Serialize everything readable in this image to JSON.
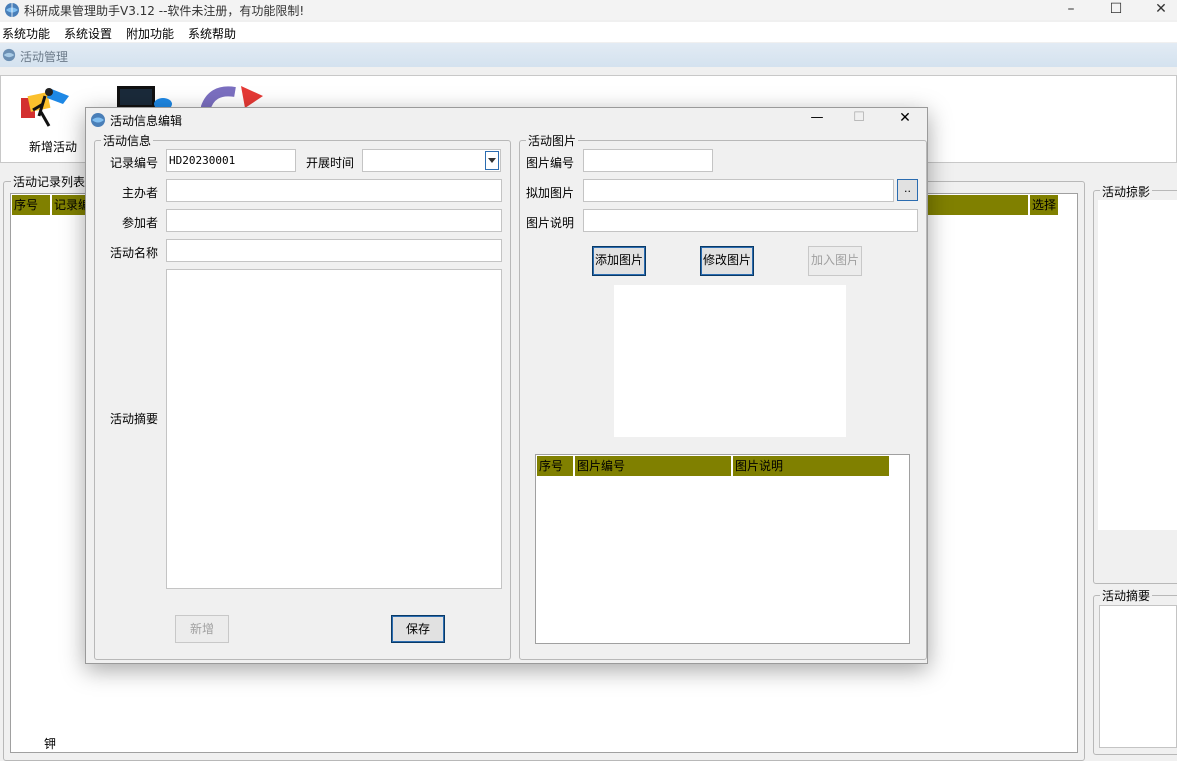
{
  "window": {
    "title": "科研成果管理助手V3.12 --软件未注册，有功能限制!",
    "minimize": "–",
    "maximize": "☐",
    "close": "✕"
  },
  "menu": [
    "系统功能",
    "系统设置",
    "附加功能",
    "系统帮助"
  ],
  "mdi": {
    "title": "活动管理"
  },
  "toolbar": {
    "new_activity": "新增活动"
  },
  "background": {
    "list_title": "活动记录列表",
    "col_seq": "序号",
    "col_record_partial": "记录编",
    "col_select": "选择",
    "photo_panel": "活动掠影",
    "summary_panel": "活动摘要",
    "bottom_fragment": "钾"
  },
  "dialog": {
    "title": "活动信息编辑",
    "minimize": "—",
    "maximize": "☐",
    "close": "✕",
    "info": {
      "legend": "活动信息",
      "record_no_label": "记录编号",
      "record_no_value": "HD20230001",
      "start_time_label": "开展时间",
      "start_time_value": "",
      "organizer_label": "主办者",
      "organizer_value": "",
      "participants_label": "参加者",
      "participants_value": "",
      "name_label": "活动名称",
      "name_value": "",
      "summary_label": "活动摘要",
      "summary_value": "",
      "add_button": "新增",
      "save_button": "保存"
    },
    "photo": {
      "legend": "活动图片",
      "photo_no_label": "图片编号",
      "photo_no_value": "",
      "attach_label": "拟加图片",
      "attach_value": "",
      "browse_button": "..",
      "desc_label": "图片说明",
      "desc_value": "",
      "add_photo_button": "添加图片",
      "edit_photo_button": "修改图片",
      "insert_photo_button": "加入图片",
      "table_headers": [
        "序号",
        "图片编号",
        "图片说明"
      ]
    }
  },
  "colors": {
    "grid_header": "#808000",
    "accent": "#2b6cb0"
  }
}
